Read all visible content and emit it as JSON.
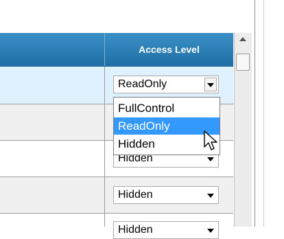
{
  "grid": {
    "header": {
      "access_level": "Access Level"
    },
    "rows": [
      {
        "access_value": "ReadOnly"
      },
      {
        "access_value": ""
      },
      {
        "access_value": "Hidden"
      },
      {
        "access_value": "Hidden"
      },
      {
        "access_value": "Hidden"
      }
    ]
  },
  "dropdown": {
    "options": [
      "FullControl",
      "ReadOnly",
      "Hidden"
    ],
    "selected": "ReadOnly"
  },
  "icons": {
    "dropdown_arrow": "chevron-down-icon",
    "cursor": "mouse-pointer-icon",
    "scroll_up": "scroll-up-icon"
  },
  "colors": {
    "header": "#2b7fb8",
    "selected_option": "#3399ff",
    "selected_row": "#dff0ff"
  }
}
